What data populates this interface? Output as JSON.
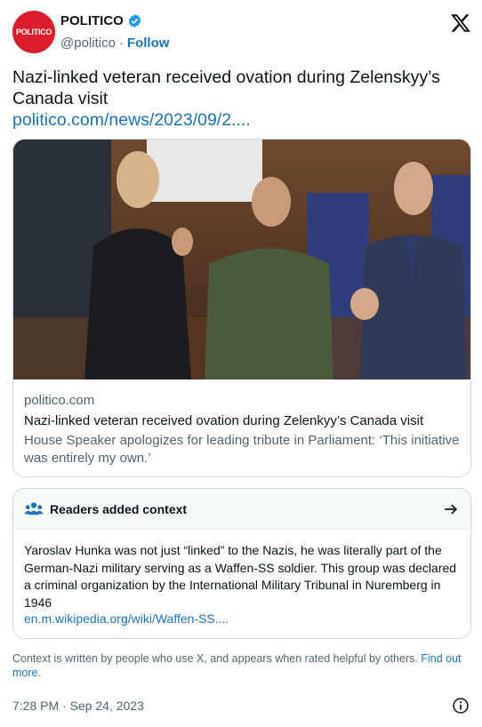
{
  "author": {
    "avatar_text": "POLITICO",
    "display_name": "POLITICO",
    "handle": "@politico",
    "separator": "·",
    "follow_label": "Follow"
  },
  "tweet": {
    "text": "Nazi-linked veteran received ovation during Zelenskyy’s Canada visit",
    "link": "politico.com/news/2023/09/2...."
  },
  "card": {
    "image_icon": "photo-parliament-ovation",
    "domain": "politico.com",
    "title": "Nazi-linked veteran received ovation during Zelenkyy’s Canada visit",
    "description": "House Speaker apologizes for leading tribute in Parliament: ‘This initiative was entirely my own.’"
  },
  "community_note": {
    "title": "Readers added context",
    "body": "Yaroslav Hunka was not just “linked” to the Nazis, he was literally part of the German-Nazi military serving as a Waffen-SS soldier. This group was declared a criminal organization by the International Military Tribunal in Nuremberg in 1946",
    "link": "en.m.wikipedia.org/wiki/Waffen-SS...."
  },
  "footnote": {
    "text": "Context is written by people who use X, and appears when rated helpful by others.",
    "link": "Find out more."
  },
  "timestamp": "7:28 PM · Sep 24, 2023",
  "colors": {
    "accent": "#1d73b8",
    "brand_red": "#dc1e2c",
    "verified": "#1d9bf0"
  }
}
